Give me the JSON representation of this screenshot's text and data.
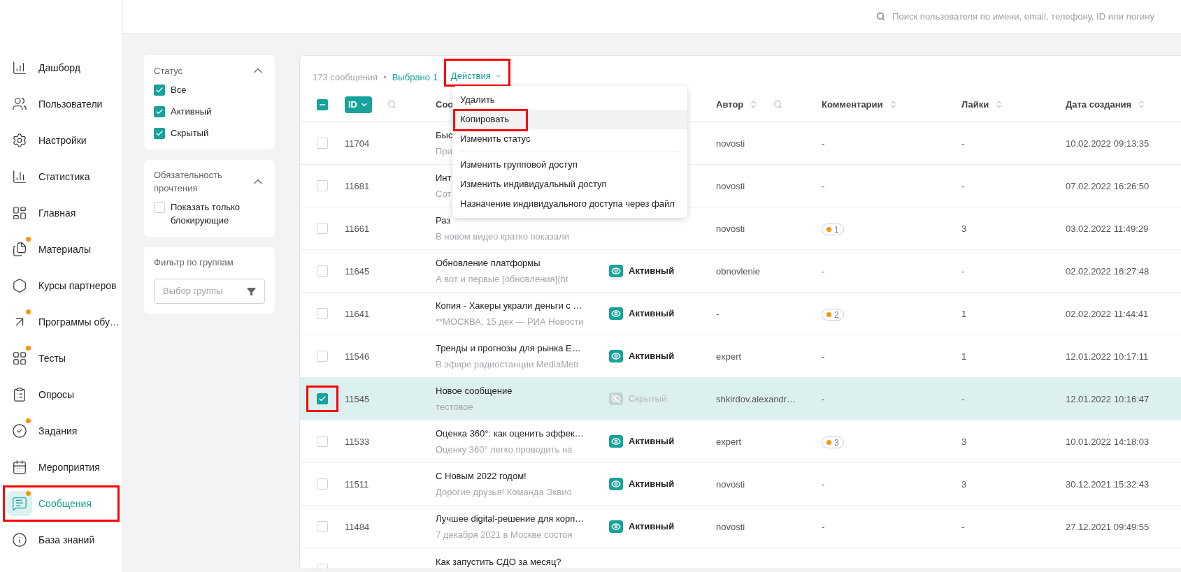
{
  "topbar": {
    "search": {
      "placeholder": "Поиск пользователя по имени, email, телефону, ID или логину"
    }
  },
  "sidebar": {
    "items": [
      {
        "label": "Дашборд",
        "selected": false,
        "dot": false,
        "highlighted": false
      },
      {
        "label": "Пользователи",
        "selected": false,
        "dot": false,
        "highlighted": false
      },
      {
        "label": "Настройки",
        "selected": false,
        "dot": false,
        "highlighted": false
      },
      {
        "label": "Статистика",
        "selected": false,
        "dot": false,
        "highlighted": false
      },
      {
        "label": "Главная",
        "selected": false,
        "dot": false,
        "highlighted": false
      },
      {
        "label": "Материалы",
        "selected": false,
        "dot": true,
        "highlighted": false
      },
      {
        "label": "Курсы партнеров",
        "selected": false,
        "dot": false,
        "highlighted": false
      },
      {
        "label": "Программы обу…",
        "selected": false,
        "dot": true,
        "highlighted": false
      },
      {
        "label": "Тесты",
        "selected": false,
        "dot": true,
        "highlighted": false
      },
      {
        "label": "Опросы",
        "selected": false,
        "dot": false,
        "highlighted": false
      },
      {
        "label": "Задания",
        "selected": false,
        "dot": true,
        "highlighted": false
      },
      {
        "label": "Мероприятия",
        "selected": false,
        "dot": false,
        "highlighted": false
      },
      {
        "label": "Сообщения",
        "selected": true,
        "dot": true,
        "highlighted": true
      },
      {
        "label": "База знаний",
        "selected": false,
        "dot": false,
        "highlighted": false
      }
    ]
  },
  "filters": [
    {
      "kind": "checklist",
      "title": "Статус",
      "expanded": true,
      "options": [
        {
          "label": "Все",
          "checked": true
        },
        {
          "label": "Активный",
          "checked": true
        },
        {
          "label": "Скрытый",
          "checked": true
        }
      ]
    },
    {
      "kind": "checklist",
      "title": "Обязательность прочтения",
      "expanded": true,
      "options": [
        {
          "label": "Показать только блокирующие",
          "checked": false
        }
      ]
    },
    {
      "kind": "select",
      "title": "Фильтр по группам",
      "placeholder": "Выбор группы"
    }
  ],
  "table": {
    "count": "173 сообщения",
    "separator": "•",
    "selected_text": "Выбрано 1",
    "actions": {
      "label": "Действия",
      "open": true,
      "highlighted": true,
      "menu": [
        {
          "kind": "item",
          "label": "Удалить",
          "hovered": false,
          "highlighted": false
        },
        {
          "kind": "item",
          "label": "Копировать",
          "hovered": true,
          "highlighted": true
        },
        {
          "kind": "item",
          "label": "Изменить статус",
          "hovered": false,
          "highlighted": false
        },
        {
          "kind": "divider"
        },
        {
          "kind": "item",
          "label": "Изменить групповой доступ",
          "hovered": false,
          "highlighted": false
        },
        {
          "kind": "item",
          "label": "Изменить индивидуальный доступ",
          "hovered": false,
          "highlighted": false
        },
        {
          "kind": "item",
          "label": "Назначение индивидуального доступа через файл",
          "hovered": false,
          "highlighted": false
        }
      ]
    },
    "select_all": {
      "indeterminate": true
    },
    "columns": [
      {
        "label": "ID",
        "active": true,
        "sortable": false,
        "search": true
      },
      {
        "label": "Соо",
        "active": false
      },
      {
        "label": "Автор",
        "active": false,
        "sortable": true,
        "search": true
      },
      {
        "label": "Комментарии",
        "active": false,
        "sortable": true,
        "search": false
      },
      {
        "label": "Лайки",
        "active": false,
        "sortable": true,
        "search": false
      },
      {
        "label": "Дата создания",
        "active": false,
        "sortable": true,
        "search": false
      }
    ],
    "rows": [
      {
        "id": "11704",
        "title": "Быс",
        "subtitle": "При",
        "author": "novosti",
        "comments": {
          "kind": "text",
          "text": "-"
        },
        "likes": "-",
        "date": "10.02.2022 09:13:35",
        "selected": false,
        "highlighted": false
      },
      {
        "id": "11681",
        "title": "Инт",
        "subtitle": "Сот",
        "author": "novosti",
        "comments": {
          "kind": "text",
          "text": "-"
        },
        "likes": "-",
        "date": "07.02.2022 16:26:50",
        "selected": false,
        "highlighted": false
      },
      {
        "id": "11661",
        "title": "Раз",
        "subtitle": "В новом видео кратко показали",
        "author": "novosti",
        "comments": {
          "kind": "badge",
          "text": "1"
        },
        "likes": "3",
        "date": "03.02.2022 11:49:29",
        "selected": false,
        "highlighted": false
      },
      {
        "id": "11645",
        "title": "Обновление платформы",
        "subtitle": "А вот и первые [обновления](ht",
        "status": {
          "label": "Активный",
          "visible": true
        },
        "author": "obnovlenie",
        "comments": {
          "kind": "text",
          "text": "-"
        },
        "likes": "-",
        "date": "02.02.2022 16:27:48",
        "selected": false,
        "highlighted": false
      },
      {
        "id": "11641",
        "title": "Копия - Хакеры украли деньги с …",
        "subtitle": "**МОСКВА, 15 дек — РИА Новости",
        "status": {
          "label": "Активный",
          "visible": true
        },
        "author": "-",
        "comments": {
          "kind": "badge",
          "text": "2"
        },
        "likes": "1",
        "date": "02.02.2022 11:44:41",
        "selected": false,
        "highlighted": false
      },
      {
        "id": "11546",
        "title": "Тренды и прогнозы для рынка E…",
        "subtitle": "В эфире радиостанции MediaMetr",
        "status": {
          "label": "Активный",
          "visible": true
        },
        "author": "expert",
        "comments": {
          "kind": "text",
          "text": "-"
        },
        "likes": "1",
        "date": "12.01.2022 10:17:11",
        "selected": false,
        "highlighted": false
      },
      {
        "id": "11545",
        "title": "Новое сообщение",
        "subtitle": "тестовое",
        "status": {
          "label": "Скрытый",
          "visible": false
        },
        "author": "shkirdov.alexandr…",
        "comments": {
          "kind": "text",
          "text": "-"
        },
        "likes": "-",
        "date": "12.01.2022 10:16:47",
        "selected": true,
        "highlighted": true
      },
      {
        "id": "11533",
        "title": "Оценка 360°: как оценить эффек…",
        "subtitle": "Оценку 360° легко проводить на",
        "status": {
          "label": "Активный",
          "visible": true
        },
        "author": "expert",
        "comments": {
          "kind": "badge",
          "text": "3"
        },
        "likes": "3",
        "date": "10.01.2022 14:18:03",
        "selected": false,
        "highlighted": false
      },
      {
        "id": "11511",
        "title": "С Новым 2022 годом!",
        "subtitle": "Дорогие друзья! Команда Эквио",
        "status": {
          "label": "Активный",
          "visible": true
        },
        "author": "novosti",
        "comments": {
          "kind": "text",
          "text": "-"
        },
        "likes": "3",
        "date": "30.12.2021 15:32:43",
        "selected": false,
        "highlighted": false
      },
      {
        "id": "11484",
        "title": "Лучшее digital-решение для корп…",
        "subtitle": "7 декабря 2021 в Москве состоя",
        "status": {
          "label": "Активный",
          "visible": true
        },
        "author": "novosti",
        "comments": {
          "kind": "text",
          "text": "-"
        },
        "likes": "-",
        "date": "27.12.2021 09:49:55",
        "selected": false,
        "highlighted": false
      },
      {
        "title": "Как запустить СДО за месяц?",
        "selected": false,
        "highlighted": false
      }
    ]
  }
}
